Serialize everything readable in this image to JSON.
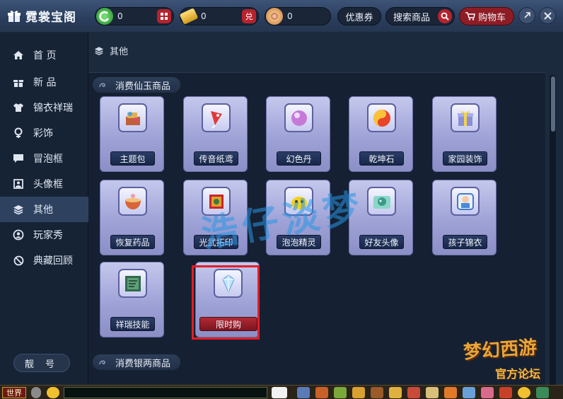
{
  "header": {
    "title": "霓裳宝阁",
    "currencies": [
      {
        "name": "green-jade-icon",
        "value": "0",
        "action_icon": "grid-icon"
      },
      {
        "name": "gold-ticket-icon",
        "value": "0",
        "action_label": "兑"
      },
      {
        "name": "silver-coin-icon",
        "value": "0"
      }
    ],
    "coupon_label": "优惠券",
    "search_label": "搜索商品",
    "cart_label": "购物车"
  },
  "sidebar": {
    "items": [
      {
        "label": "首 页",
        "icon": "home-icon"
      },
      {
        "label": "新 品",
        "icon": "gift-icon"
      },
      {
        "label": "锦衣祥瑞",
        "icon": "shirt-icon"
      },
      {
        "label": "彩饰",
        "icon": "ornament-icon"
      },
      {
        "label": "冒泡框",
        "icon": "chat-bubble-icon"
      },
      {
        "label": "头像框",
        "icon": "portrait-frame-icon"
      },
      {
        "label": "其他",
        "icon": "layers-icon"
      },
      {
        "label": "玩家秀",
        "icon": "player-show-icon"
      },
      {
        "label": "典藏回顾",
        "icon": "ban-icon"
      }
    ],
    "active_index": 6,
    "bottom_button": "靓 号"
  },
  "breadcrumb": "其他",
  "sections": [
    {
      "title": "消费仙玉商品"
    },
    {
      "title": "消费银两商品"
    }
  ],
  "products": [
    {
      "label": "主题包",
      "icon": "treasure-pile-icon"
    },
    {
      "label": "传音纸鸢",
      "icon": "paper-kite-icon"
    },
    {
      "label": "幻色丹",
      "icon": "purple-pill-icon"
    },
    {
      "label": "乾坤石",
      "icon": "red-stone-icon"
    },
    {
      "label": "家园装饰",
      "icon": "gift-box-icon"
    },
    {
      "label": "恢复药品",
      "icon": "medicine-bowl-icon"
    },
    {
      "label": "光武拓印",
      "icon": "red-chest-icon"
    },
    {
      "label": "泡泡精灵",
      "icon": "bubble-sprite-icon"
    },
    {
      "label": "好友头像",
      "icon": "friend-avatar-icon"
    },
    {
      "label": "孩子锦衣",
      "icon": "child-outfit-icon"
    },
    {
      "label": "祥瑞技能",
      "icon": "skill-scroll-icon"
    },
    {
      "label": "限时购",
      "icon": "crystal-diamond-icon"
    }
  ],
  "watermark": "浩仔淡梦",
  "game_bar": {
    "channel": "世界"
  },
  "brand_logo": "梦幻西游",
  "brand_sub": "官方论坛",
  "colors": {
    "accent_red": "#b6232e",
    "card_bg": "#a3a7d9",
    "highlight": "#e21e26"
  }
}
